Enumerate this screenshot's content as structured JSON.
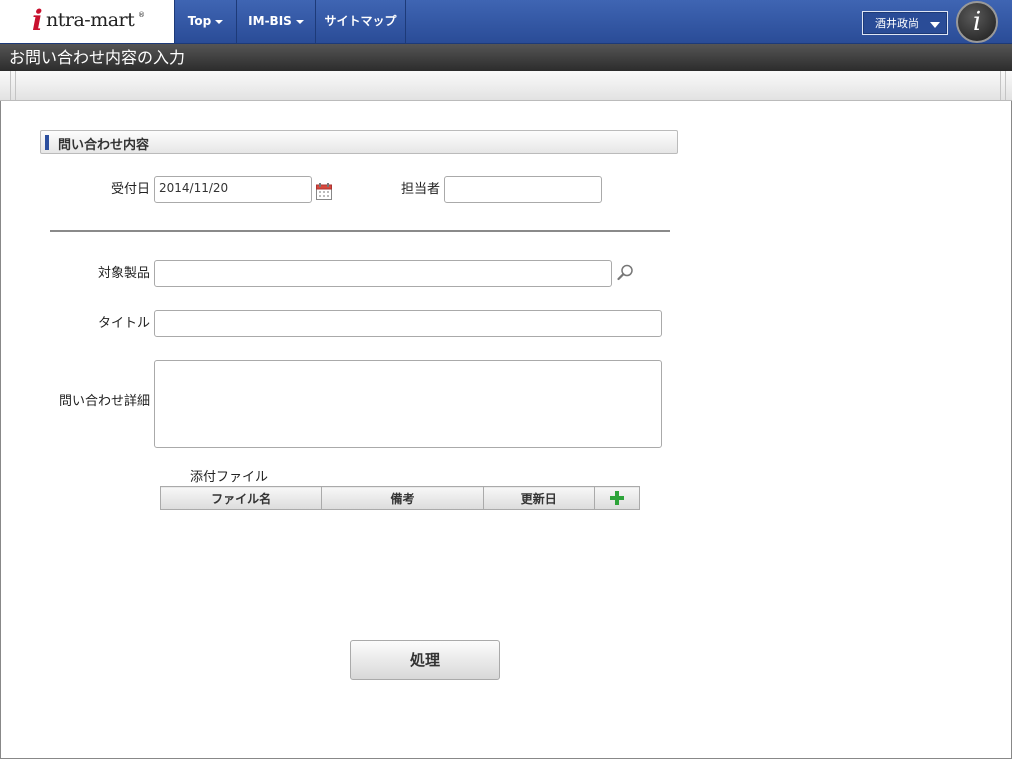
{
  "header": {
    "logo": "intra-mart",
    "nav": [
      {
        "label": "Top",
        "has_menu": true
      },
      {
        "label": "IM-BIS",
        "has_menu": true
      },
      {
        "label": "サイトマップ",
        "has_menu": false
      }
    ],
    "user_name": "酒井政尚",
    "avatar_glyph": "i"
  },
  "page": {
    "title": "お問い合わせ内容の入力"
  },
  "form": {
    "section_title": "問い合わせ内容",
    "receipt_date": {
      "label": "受付日",
      "value": "2014/11/20"
    },
    "assignee": {
      "label": "担当者",
      "value": ""
    },
    "product": {
      "label": "対象製品",
      "value": ""
    },
    "title_field": {
      "label": "タイトル",
      "value": ""
    },
    "detail": {
      "label": "問い合わせ詳細",
      "value": ""
    },
    "attachments": {
      "label": "添付ファイル",
      "columns": [
        "ファイル名",
        "備考",
        "更新日"
      ],
      "rows": []
    },
    "submit_label": "処理"
  },
  "colors": {
    "nav_blue": "#2a4c97",
    "title_dark": "#2c2c2c",
    "section_accent": "#2c4f9e",
    "add_green": "#2ea43a"
  },
  "icons": [
    "calendar-icon",
    "search-icon",
    "add-icon",
    "chevron-down-icon"
  ]
}
